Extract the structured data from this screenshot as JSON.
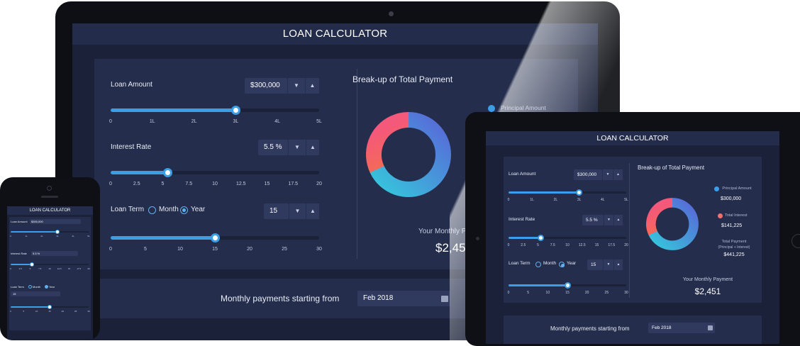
{
  "app": {
    "title": "LOAN CALCULATOR"
  },
  "colors": {
    "accent": "#3b9ee6",
    "principal": "#3b9ee6",
    "interest": "#f36e6e"
  },
  "loan_amount": {
    "label": "Loan Amount",
    "value": "$300,000",
    "slider_fraction": 0.6,
    "ticks": [
      "0",
      "1L",
      "2L",
      "3L",
      "4L",
      "5L"
    ]
  },
  "interest_rate": {
    "label": "Interest Rate",
    "value": "5.5 %",
    "slider_fraction": 0.275,
    "ticks": [
      "0",
      "2.5",
      "5",
      "7.5",
      "10",
      "12.5",
      "15",
      "17.5",
      "20"
    ]
  },
  "loan_term": {
    "label": "Loan Term",
    "option_month": "Month",
    "option_year": "Year",
    "selected": "Year",
    "value": "15",
    "slider_fraction": 0.5,
    "ticks": [
      "0",
      "5",
      "10",
      "15",
      "20",
      "25",
      "30"
    ]
  },
  "breakup": {
    "title": "Break-up of Total Payment",
    "principal_label": "Principal Amount",
    "principal_value": "$300,000",
    "interest_label": "Total Interest",
    "interest_value": "$141,225",
    "total_label": "Total Payment",
    "total_sub": "(Principal + Interest)",
    "total_value": "$441,225",
    "principal_fraction": 0.68,
    "interest_fraction": 0.32
  },
  "monthly": {
    "label": "Your Monthly Payment",
    "label_partial": "Your Monthly P",
    "value": "$2,451",
    "value_partial": "$2,45"
  },
  "payments_start": {
    "label": "Monthly payments starting from",
    "value": "Feb 2018"
  },
  "icons": {
    "down": "▼",
    "up": "▲"
  }
}
